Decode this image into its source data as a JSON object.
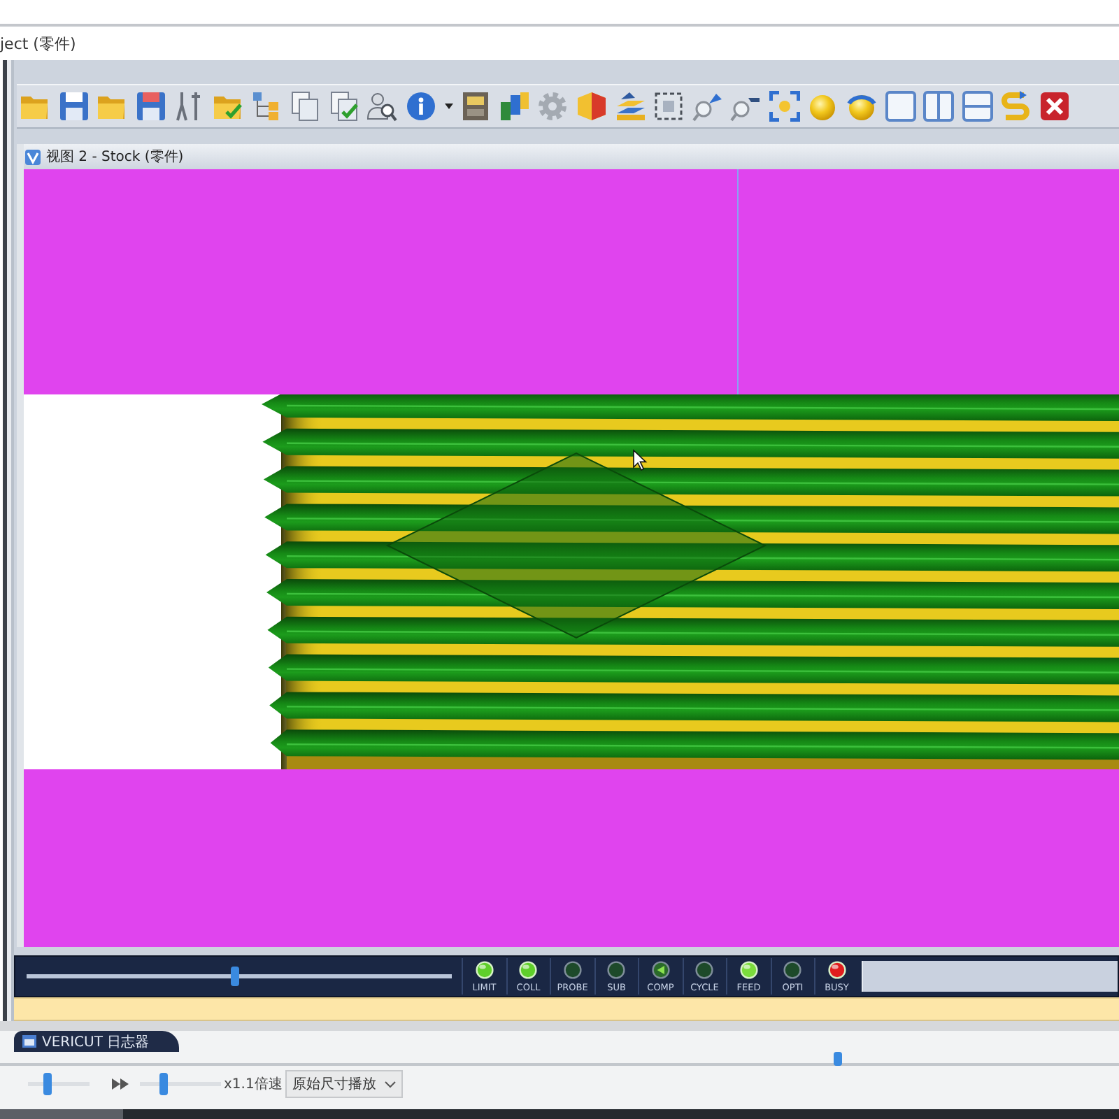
{
  "window": {
    "title": "ject (零件)"
  },
  "view": {
    "title": "视图 2 - Stock (零件)"
  },
  "playback": {
    "level": 0.49
  },
  "status_lights": [
    {
      "label": "LIMIT",
      "kind": "lamp",
      "lit": true,
      "color": "#5fcf2a"
    },
    {
      "label": "COLL",
      "kind": "lamp",
      "lit": true,
      "color": "#5fcf2a"
    },
    {
      "label": "PROBE",
      "kind": "lamp",
      "lit": false,
      "color": "#1d4a2a"
    },
    {
      "label": "SUB",
      "kind": "lamp",
      "lit": false,
      "color": "#1d4a2a"
    },
    {
      "label": "COMP",
      "kind": "arrow",
      "lit": false,
      "color": "#2a6a2a"
    },
    {
      "label": "CYCLE",
      "kind": "lamp",
      "lit": false,
      "color": "#1d4a2a"
    },
    {
      "label": "FEED",
      "kind": "lamp",
      "lit": true,
      "color": "#7bdc3c"
    },
    {
      "label": "OPTI",
      "kind": "lamp",
      "lit": false,
      "color": "#1d4a2a"
    },
    {
      "label": "BUSY",
      "kind": "lamp",
      "lit": true,
      "color": "#e01e1e"
    }
  ],
  "logger_tab": {
    "label": "VERICUT 日志器",
    "selected": true
  },
  "player": {
    "seek": {
      "level": 0.75
    },
    "volume": {
      "level": 0.3
    },
    "speed": {
      "level": 0.27,
      "label": "x1.1倍速"
    },
    "size_mode": {
      "value": "原始尺寸播放"
    }
  }
}
